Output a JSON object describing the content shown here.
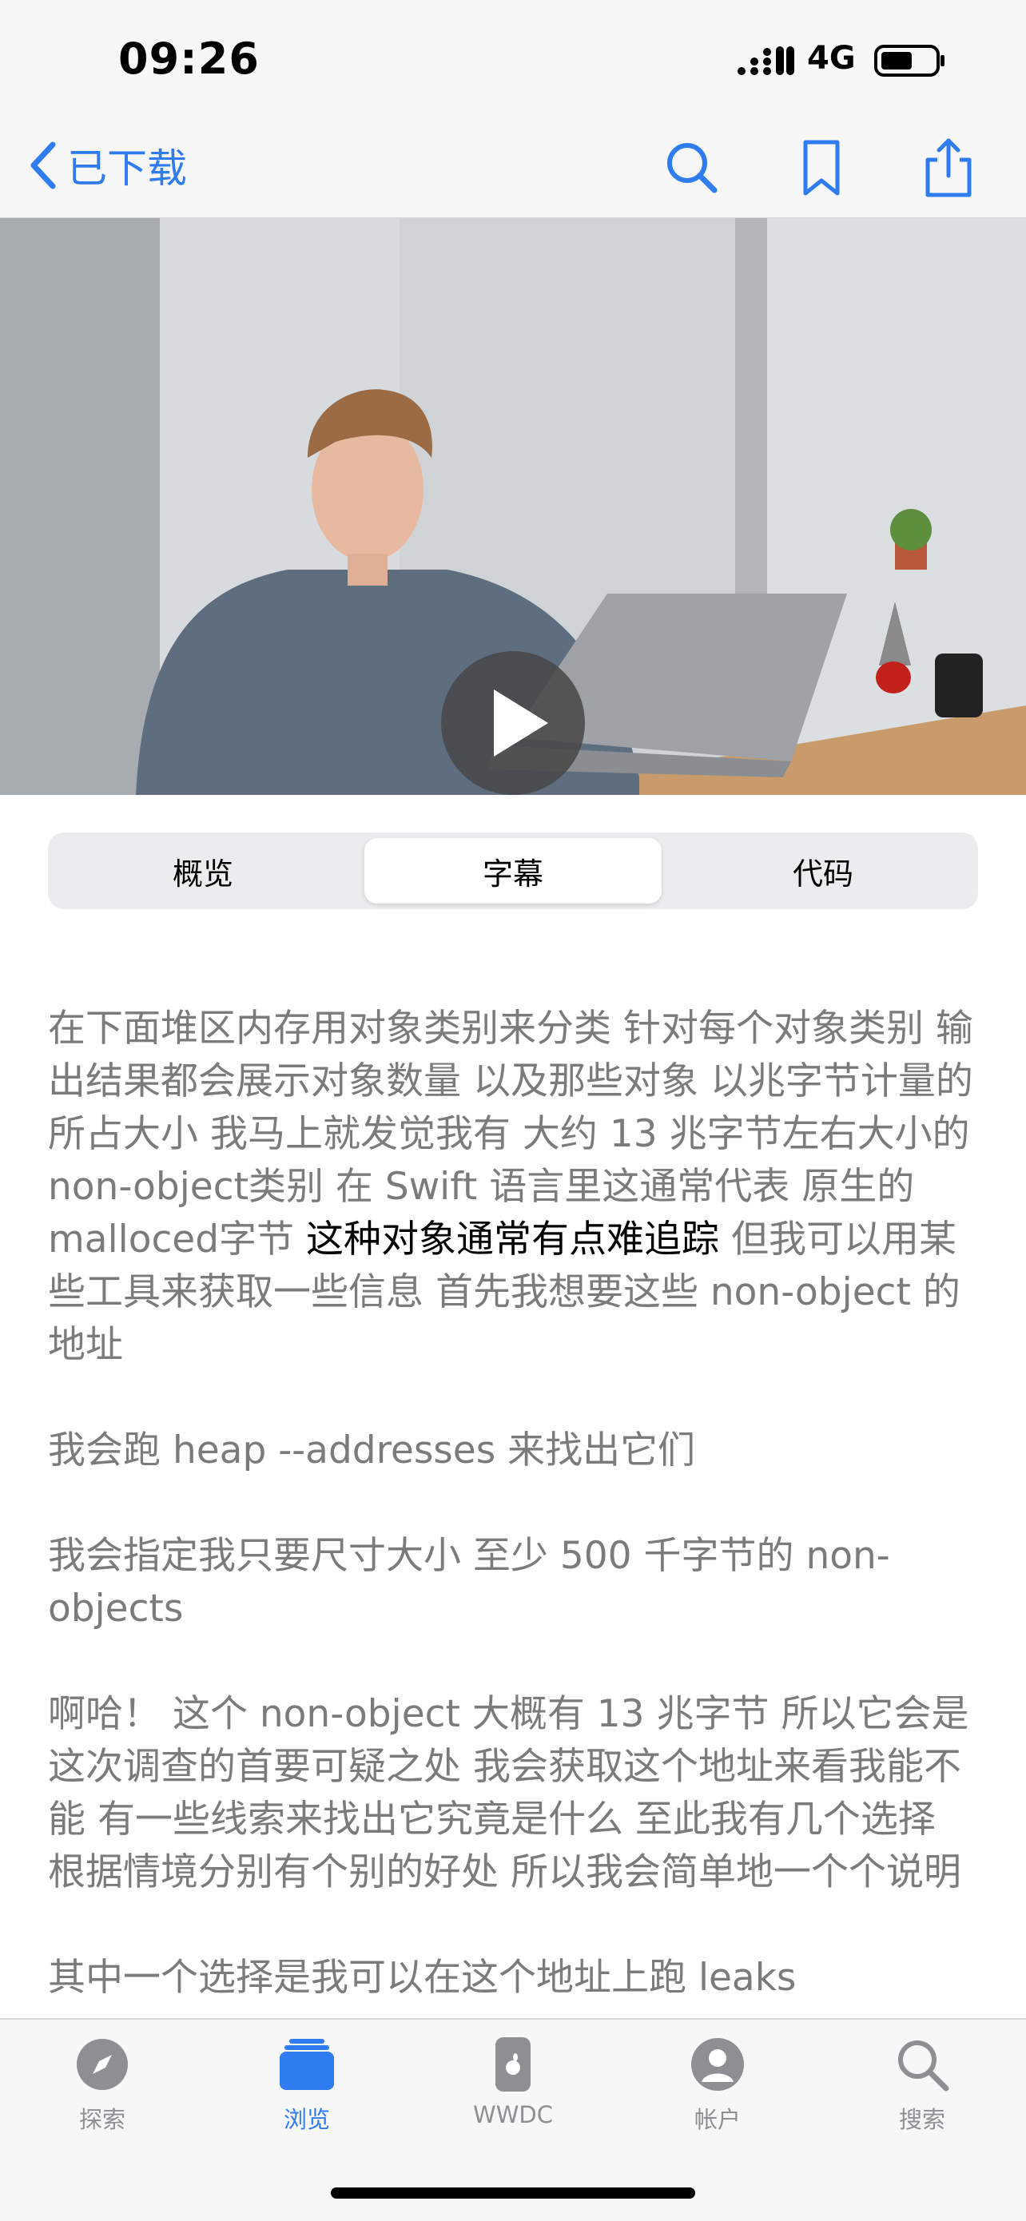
{
  "status": {
    "time": "09:26",
    "network": "4G"
  },
  "nav": {
    "back_label": "已下载"
  },
  "segments": [
    "概览",
    "字幕",
    "代码"
  ],
  "active_segment": "字幕",
  "transcript": {
    "p1_before": "在下面堆区内存用对象类别来分类 针对每个对象类别 输出结果都会展示对象数量 以及那些对象 以兆字节计量的所占大小 我马上就发觉我有 大约 13 兆字节左右大小的 non-object类别 在 Swift 语言里这通常代表 原生的 malloced字节 ",
    "p1_highlight": "这种对象通常有点难追踪",
    "p1_after": " 但我可以用某些工具来获取一些信息 首先我想要这些 non-object 的地址",
    "p2": "我会跑 heap --addresses 来找出它们",
    "p3": "我会指定我只要尺寸大小 至少 500 千字节的 non-objects",
    "p4": "啊哈！  这个 non-object 大概有 13 兆字节 所以它会是这次调查的首要可疑之处 我会获取这个地址来看我能不能 有一些线索来找出它究竟是什么 至此我有几个选择 根据情境分别有个别的好处 所以我会简单地一个个说明",
    "p5": "其中一个选择是我可以在这个地址上跑 leaks"
  },
  "tabs": [
    {
      "label": "探索",
      "icon": "compass-icon"
    },
    {
      "label": "浏览",
      "icon": "stack-icon"
    },
    {
      "label": "WWDC",
      "icon": "wwdc-icon"
    },
    {
      "label": "帐户",
      "icon": "account-icon"
    },
    {
      "label": "搜索",
      "icon": "search-icon"
    }
  ],
  "active_tab": "浏览",
  "colors": {
    "accent": "#2f7bf0",
    "text_dim": "#7b7b7b",
    "bar_bg": "#f7f7f7"
  }
}
